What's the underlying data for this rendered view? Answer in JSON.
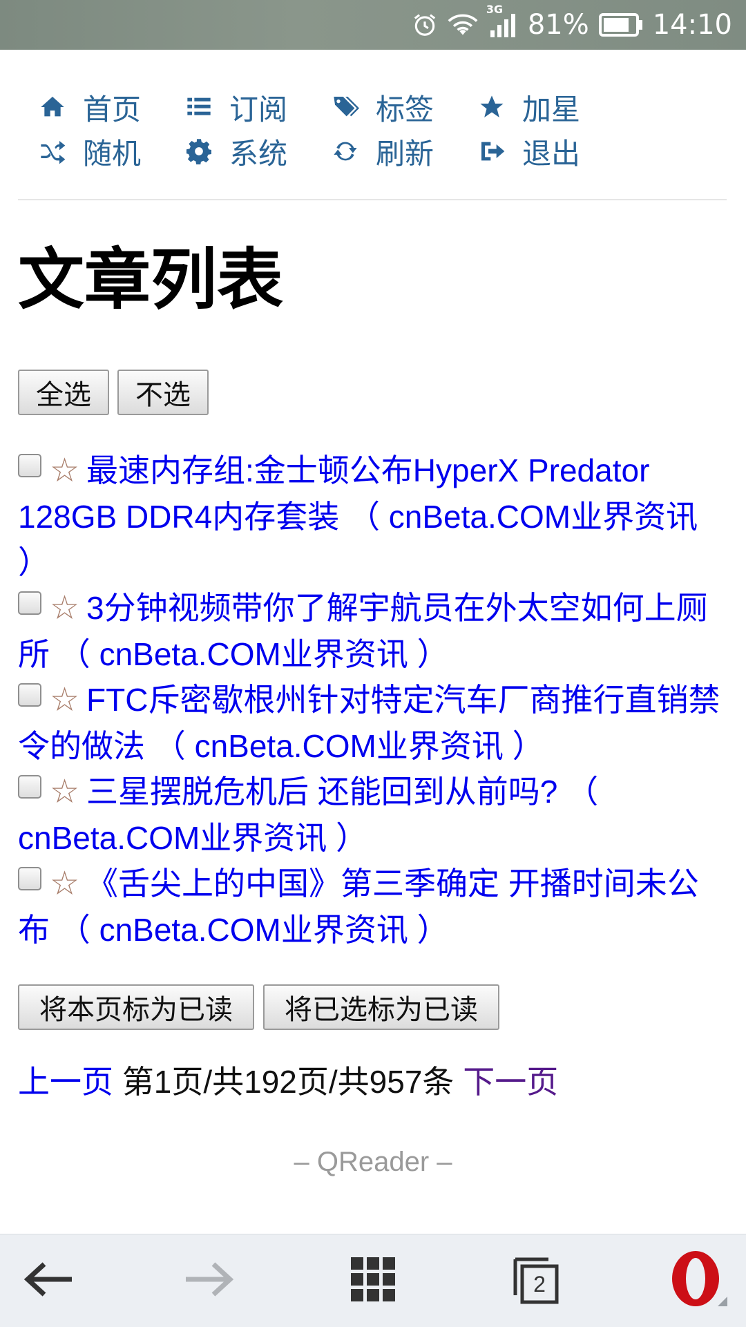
{
  "status_bar": {
    "network": "3G",
    "battery": "81%",
    "time": "14:10"
  },
  "nav": {
    "items": [
      {
        "label": "首页",
        "icon": "home-icon"
      },
      {
        "label": "订阅",
        "icon": "list-icon"
      },
      {
        "label": "标签",
        "icon": "tags-icon"
      },
      {
        "label": "加星",
        "icon": "star-icon"
      },
      {
        "label": "随机",
        "icon": "shuffle-icon"
      },
      {
        "label": "系统",
        "icon": "gear-icon"
      },
      {
        "label": "刷新",
        "icon": "refresh-icon"
      },
      {
        "label": "退出",
        "icon": "sign-out-icon"
      }
    ]
  },
  "page_title": "文章列表",
  "buttons": {
    "select_all": "全选",
    "select_none": "不选",
    "mark_page_read": "将本页标为已读",
    "mark_selected_read": "将已选标为已读"
  },
  "star_glyph": "☆",
  "articles": [
    {
      "title": "最速内存组:金士顿公布HyperX Predator 128GB DDR4内存套装",
      "source": "cnBeta.COM业界资讯"
    },
    {
      "title": "3分钟视频带你了解宇航员在外太空如何上厕所",
      "source": "cnBeta.COM业界资讯"
    },
    {
      "title": "FTC斥密歇根州针对特定汽车厂商推行直销禁令的做法",
      "source": "cnBeta.COM业界资讯"
    },
    {
      "title": "三星摆脱危机后 还能回到从前吗?",
      "source": "cnBeta.COM业界资讯"
    },
    {
      "title": "《舌尖上的中国》第三季确定 开播时间未公布",
      "source": "cnBeta.COM业界资讯"
    }
  ],
  "pager": {
    "prev": "上一页",
    "info": "第1页/共192页/共957条",
    "next": "下一页"
  },
  "footer": "– QReader –",
  "bottom_bar": {
    "tab_count": "2"
  },
  "colors": {
    "nav_link": "#2a6496",
    "article_link": "#0000ee",
    "visited_link": "#551a8b",
    "opera_red": "#cc0f16"
  }
}
